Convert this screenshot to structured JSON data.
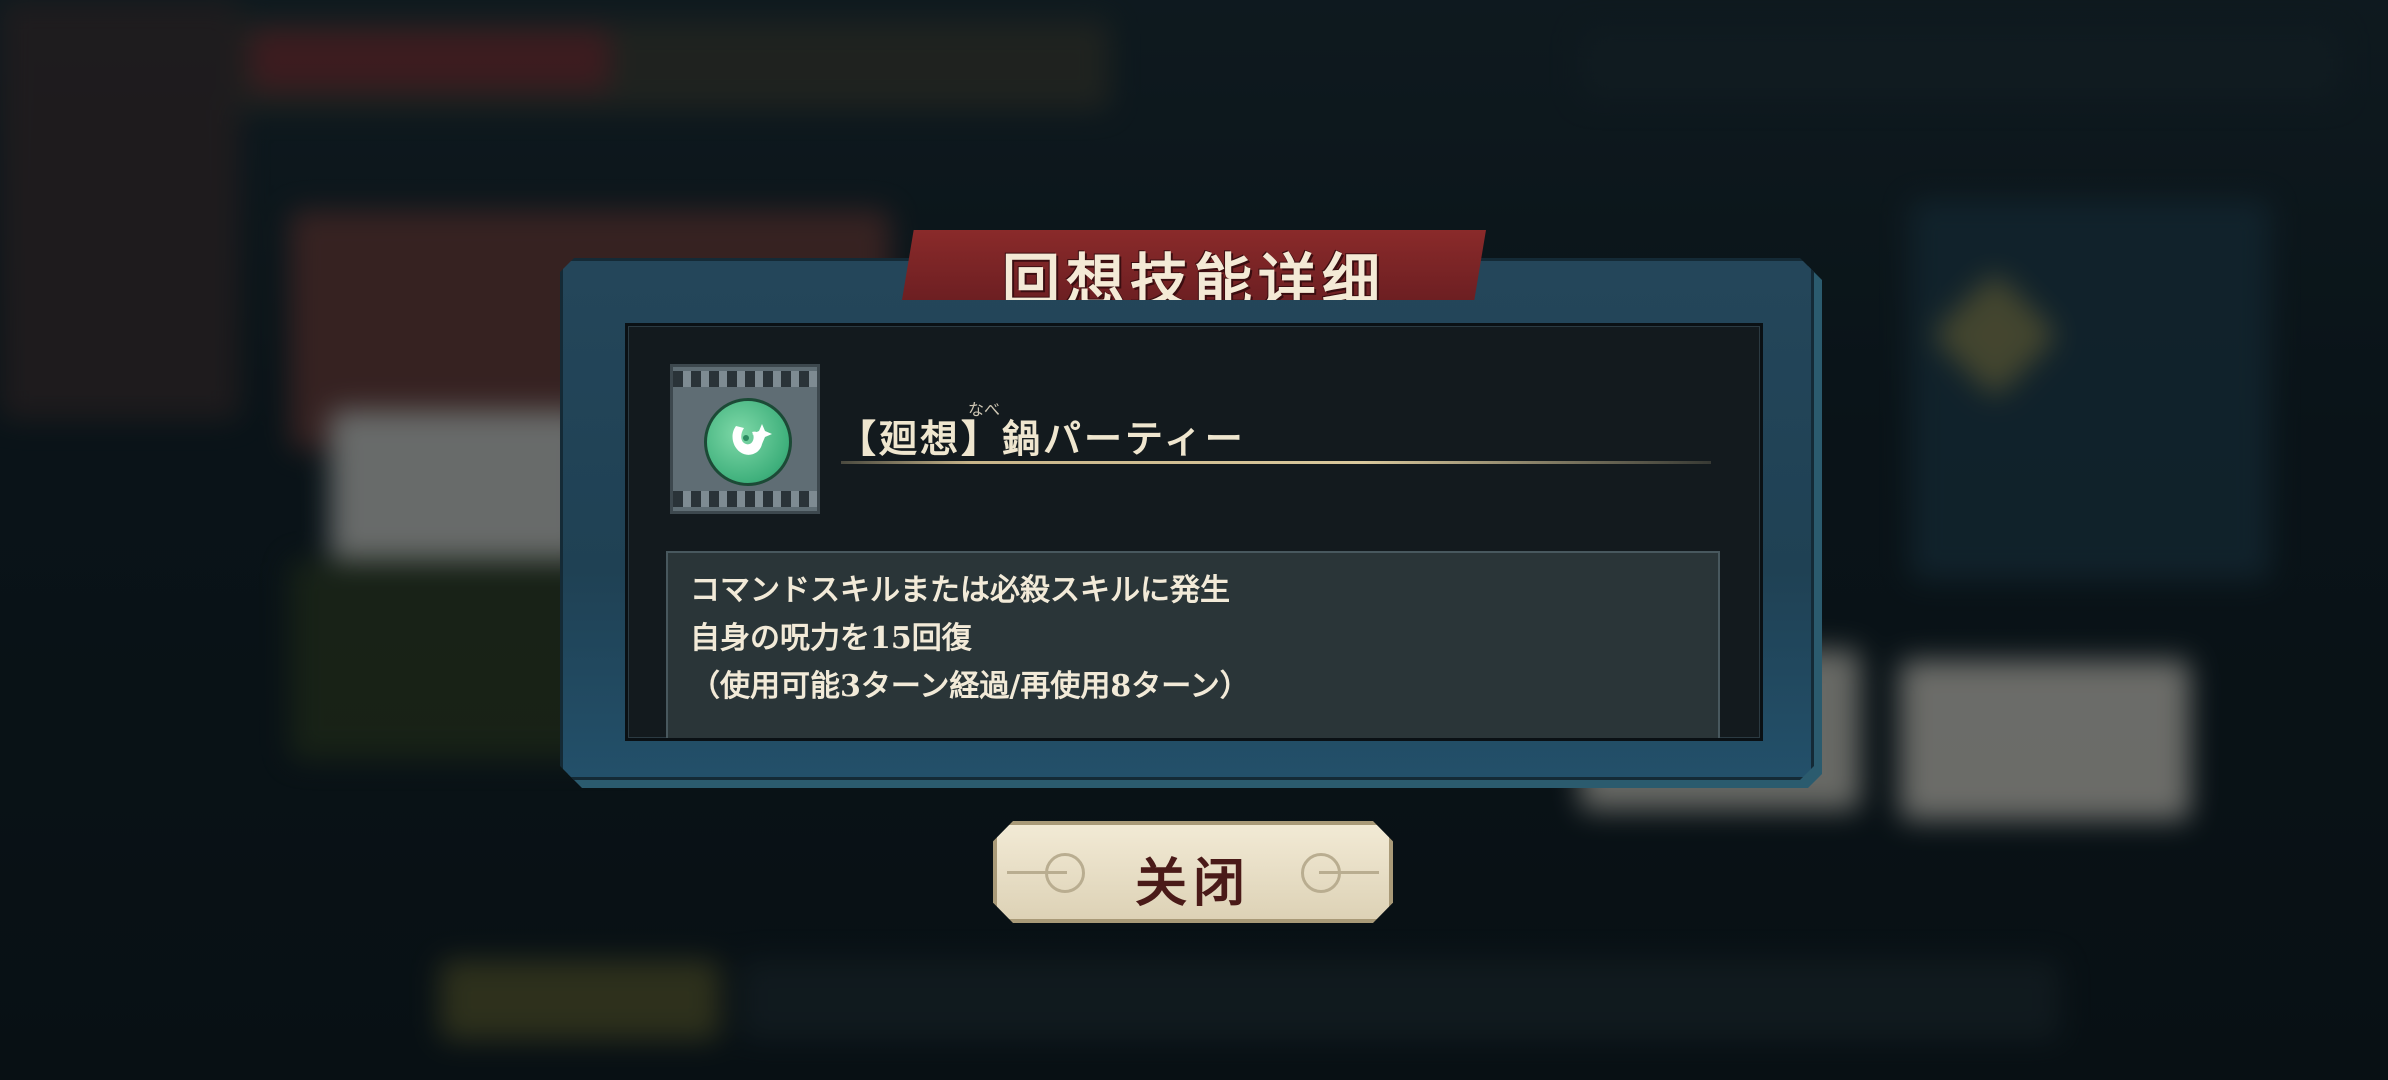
{
  "dialog": {
    "title": "回想技能详细",
    "skill": {
      "icon": "horned-spirit-badge-icon",
      "ruby": "なべ",
      "name": "【廻想】鍋パーティー"
    },
    "description": [
      "コマンドスキルまたは必殺スキルに発生",
      "自身の呪力を15回復",
      "（使用可能3ターン経過/再使用8ターン）"
    ]
  },
  "close_button": {
    "label": "关闭"
  },
  "colors": {
    "title_banner": "#7a2426",
    "frame": "#24465a",
    "skill_badge": "#3fb07c",
    "scrollbar_thumb": "#f0e5b5"
  }
}
